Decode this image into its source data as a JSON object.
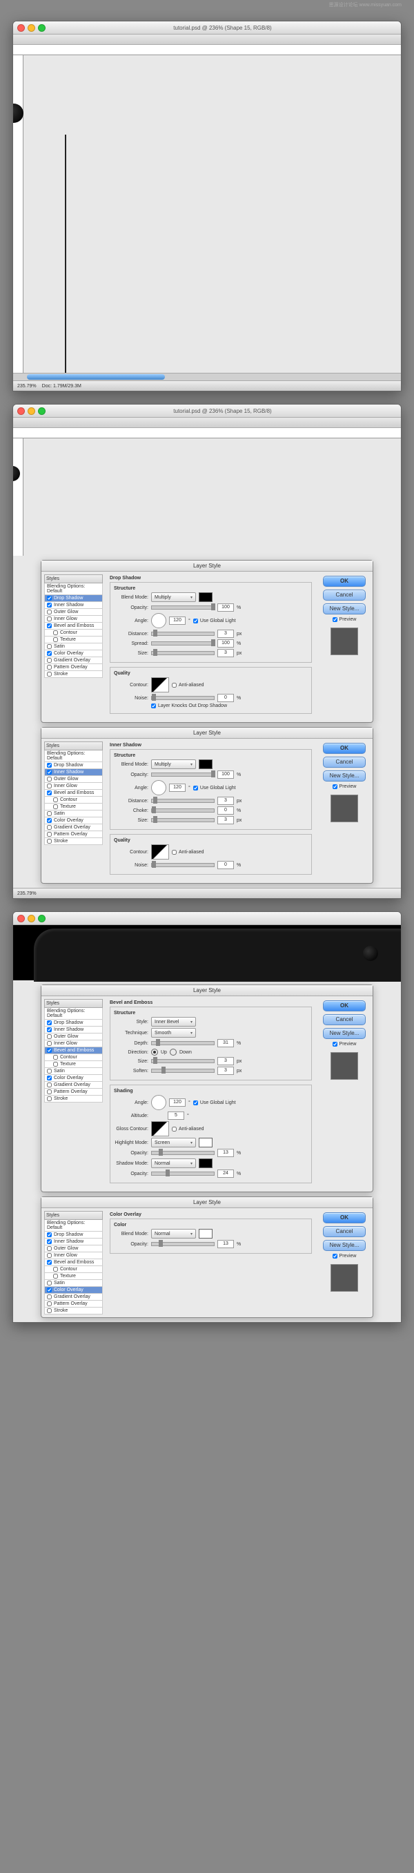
{
  "watermark": "思源设计论坛  www.missyuan.com",
  "window": {
    "title": "tutorial.psd @ 236% (Shape 15, RGB/8)",
    "zoom": "235.79%",
    "docinfo": "Doc: 1.79M/29.3M"
  },
  "dialog": {
    "title": "Layer Style",
    "side_header": "Styles",
    "blending": "Blending Options: Default",
    "effects": {
      "drop_shadow": "Drop Shadow",
      "inner_shadow": "Inner Shadow",
      "outer_glow": "Outer Glow",
      "inner_glow": "Inner Glow",
      "bevel_emboss": "Bevel and Emboss",
      "contour": "Contour",
      "texture": "Texture",
      "satin": "Satin",
      "color_overlay": "Color Overlay",
      "gradient_overlay": "Gradient Overlay",
      "pattern_overlay": "Pattern Overlay",
      "stroke": "Stroke"
    },
    "btn_ok": "OK",
    "btn_cancel": "Cancel",
    "btn_newstyle": "New Style...",
    "preview": "Preview",
    "labels": {
      "structure": "Structure",
      "blend_mode": "Blend Mode:",
      "opacity": "Opacity:",
      "angle": "Angle:",
      "use_global": "Use Global Light",
      "distance": "Distance:",
      "spread": "Spread:",
      "choke": "Choke:",
      "size": "Size:",
      "quality": "Quality",
      "contour": "Contour:",
      "anti_aliased": "Anti-aliased",
      "noise": "Noise:",
      "knocks_out": "Layer Knocks Out Drop Shadow",
      "px": "px",
      "pct": "%",
      "deg": "°",
      "style": "Style:",
      "technique": "Technique:",
      "depth": "Depth:",
      "direction": "Direction:",
      "up": "Up",
      "down": "Down",
      "soften": "Soften:",
      "shading": "Shading",
      "altitude": "Altitude:",
      "gloss_contour": "Gloss Contour:",
      "highlight_mode": "Highlight Mode:",
      "shadow_mode": "Shadow Mode:",
      "color": "Color",
      "b_multiply": "Multiply",
      "b_screen": "Screen",
      "b_normal": "Normal",
      "s_inner_bevel": "Inner Bevel",
      "t_smooth": "Smooth"
    }
  },
  "panels": {
    "drop_shadow": {
      "title": "Drop Shadow",
      "opacity": "100",
      "angle": "120",
      "distance": "3",
      "spread": "100",
      "size": "3",
      "noise": "0"
    },
    "inner_shadow": {
      "title": "Inner Shadow",
      "opacity": "100",
      "angle": "120",
      "distance": "3",
      "choke": "0",
      "size": "3",
      "noise": "0"
    },
    "bevel": {
      "title": "Bevel and Emboss",
      "depth": "31",
      "size": "3",
      "soften": "3",
      "angle": "120",
      "altitude": "5",
      "hl_opacity": "13",
      "sh_opacity": "24"
    },
    "color_overlay": {
      "title": "Color Overlay",
      "opacity": "13"
    }
  }
}
